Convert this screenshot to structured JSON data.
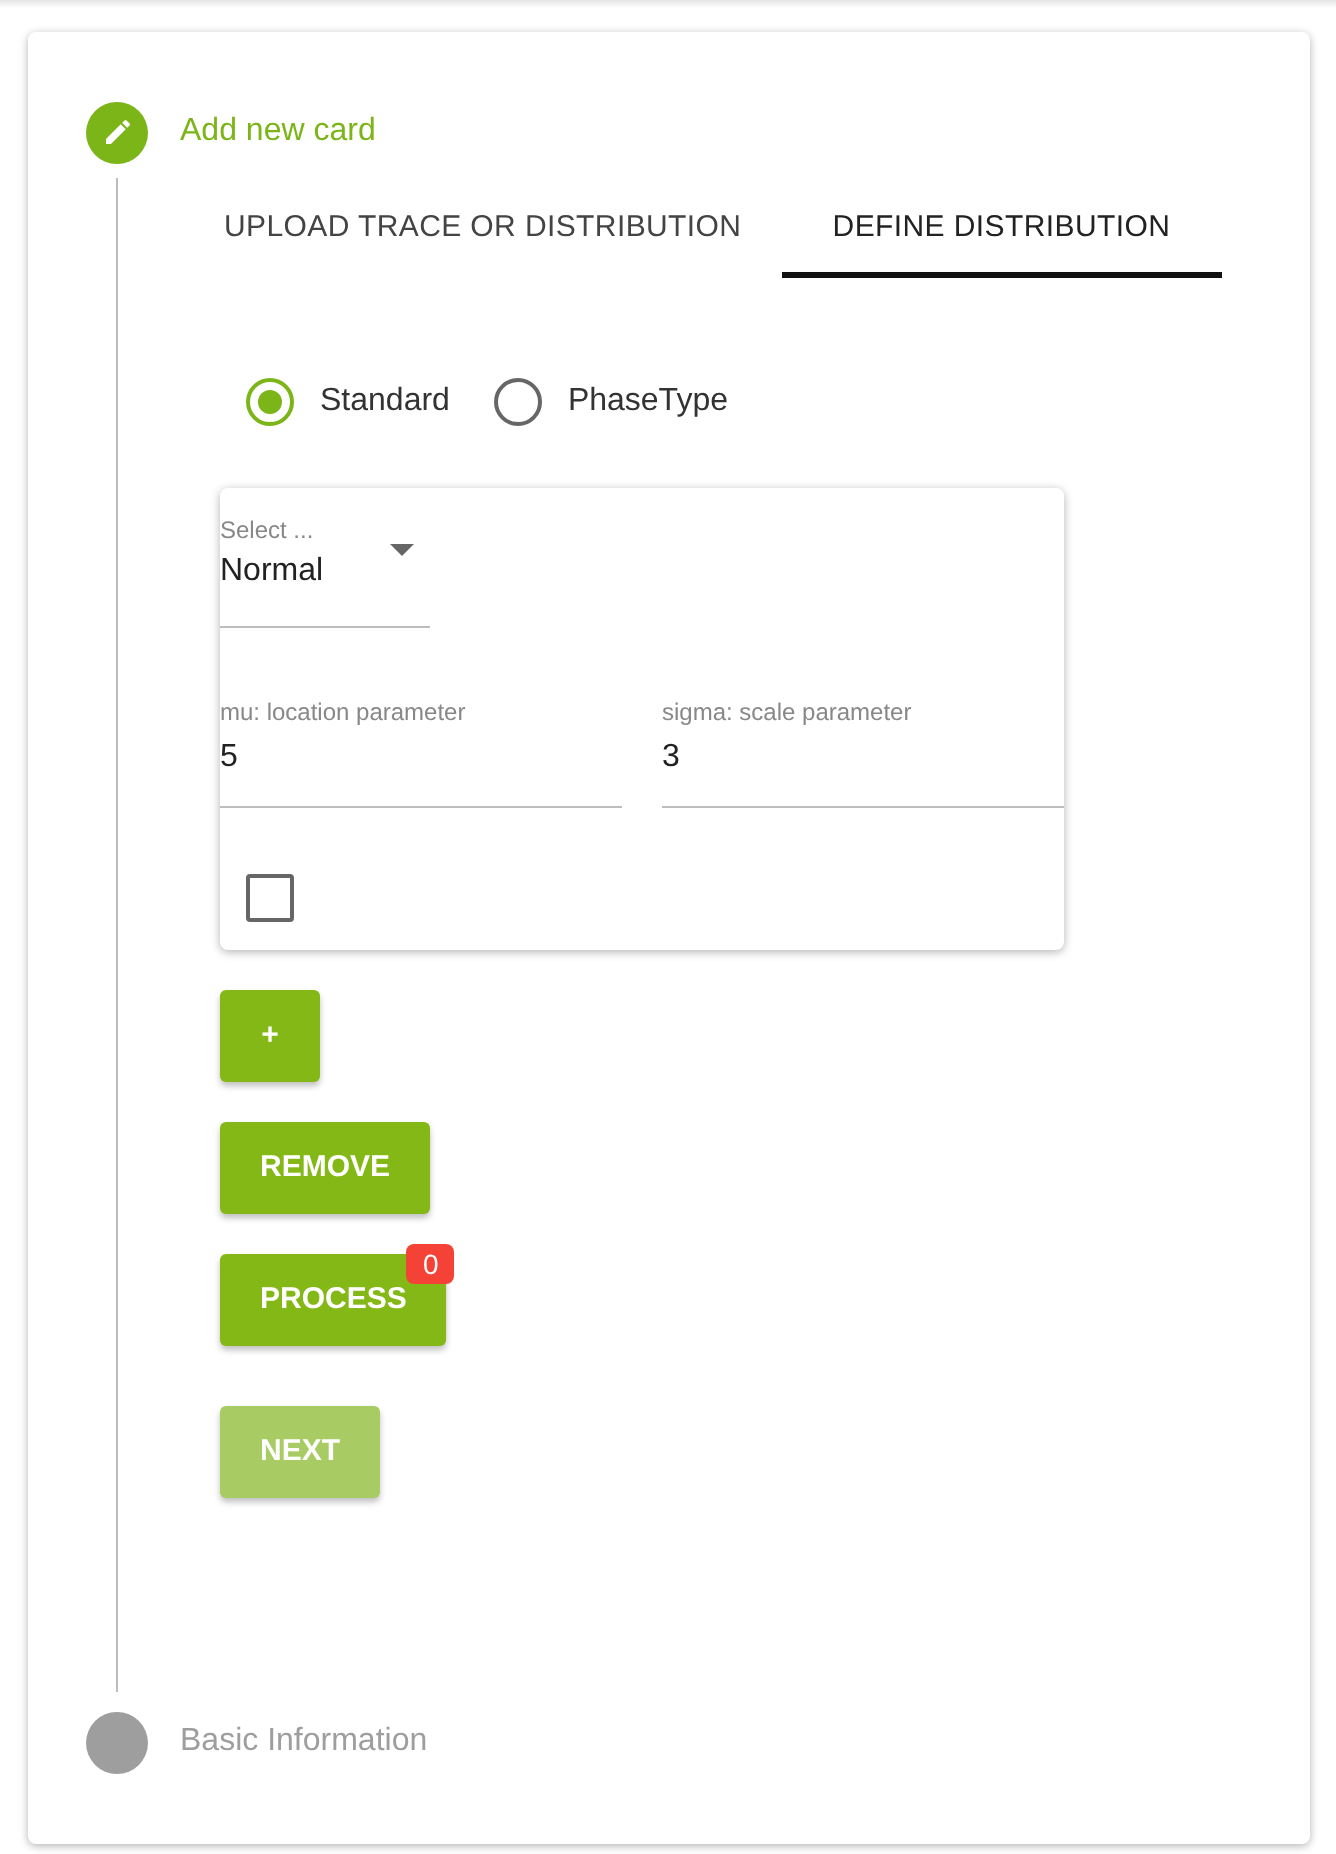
{
  "steps": [
    {
      "label": "Add new card",
      "active": true
    },
    {
      "label": "Basic Information",
      "active": false
    }
  ],
  "tabs": [
    {
      "label": "UPLOAD TRACE OR DISTRIBUTION",
      "selected": false
    },
    {
      "label": "DEFINE DISTRIBUTION",
      "selected": true
    }
  ],
  "distribution_types": [
    {
      "label": "Standard",
      "selected": true
    },
    {
      "label": "PhaseType",
      "selected": false
    }
  ],
  "distribution_card": {
    "select": {
      "label": "Select ...",
      "value": "Normal"
    },
    "parameters": [
      {
        "label": "mu: location parameter",
        "value": "5"
      },
      {
        "label": "sigma: scale parameter",
        "value": "3"
      }
    ],
    "checkbox": {
      "checked": false
    }
  },
  "buttons": [
    {
      "label": "+",
      "disabled": false
    },
    {
      "label": "REMOVE",
      "disabled": false
    },
    {
      "label": "PROCESS",
      "disabled": false,
      "badge": "0"
    },
    {
      "label": "NEXT",
      "disabled": true
    }
  ]
}
